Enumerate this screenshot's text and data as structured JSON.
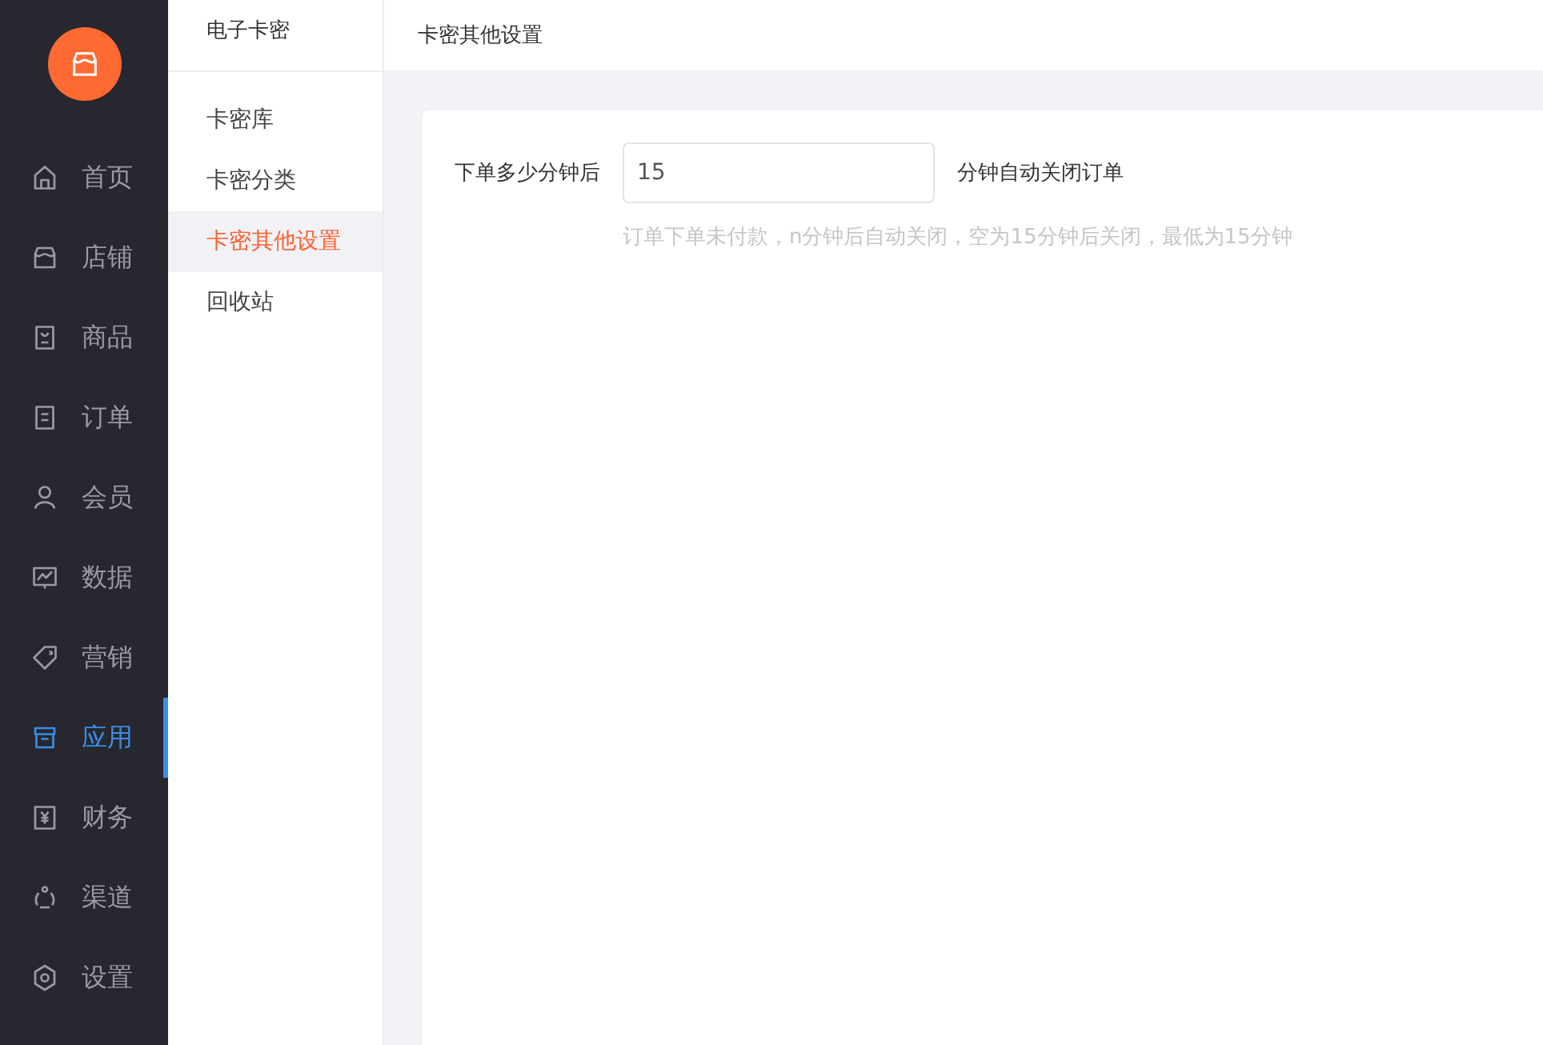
{
  "nav": [
    {
      "label": "首页",
      "selected": false
    },
    {
      "label": "店铺",
      "selected": false
    },
    {
      "label": "商品",
      "selected": false
    },
    {
      "label": "订单",
      "selected": false
    },
    {
      "label": "会员",
      "selected": false
    },
    {
      "label": "数据",
      "selected": false
    },
    {
      "label": "营销",
      "selected": false
    },
    {
      "label": "应用",
      "selected": true
    },
    {
      "label": "财务",
      "selected": false
    },
    {
      "label": "渠道",
      "selected": false
    },
    {
      "label": "设置",
      "selected": false
    }
  ],
  "submenu": {
    "title": "电子卡密",
    "items": [
      {
        "label": "卡密库",
        "selected": false
      },
      {
        "label": "卡密分类",
        "selected": false
      },
      {
        "label": "卡密其他设置",
        "selected": true
      },
      {
        "label": "回收站",
        "selected": false
      }
    ]
  },
  "page": {
    "title": "卡密其他设置"
  },
  "form": {
    "label": "下单多少分钟后",
    "value": "15",
    "suffix": "分钟自动关闭订单",
    "hint": "订单下单未付款，n分钟后自动关闭，空为15分钟后关闭，最低为15分钟"
  }
}
